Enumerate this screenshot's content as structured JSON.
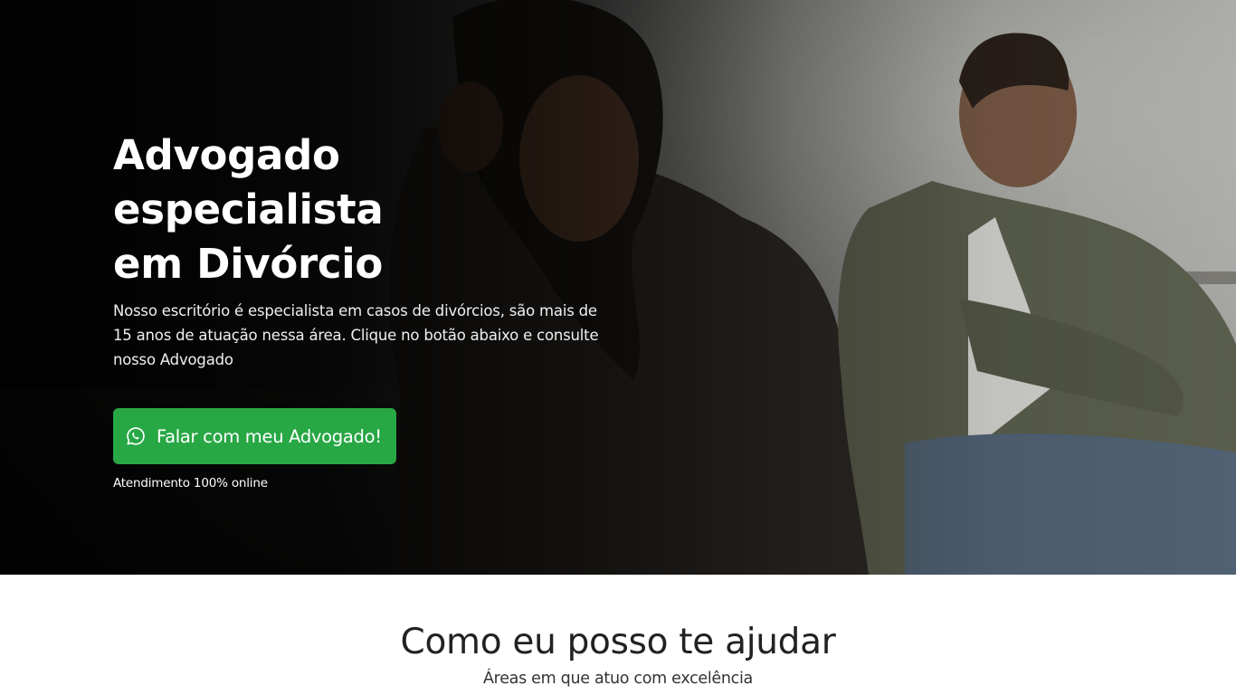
{
  "hero": {
    "title_line1": "Advogado especialista",
    "title_line2": "em Divórcio",
    "description": "Nosso escritório é especialista em casos de divórcios, são mais de 15 anos de atuação nessa área. Clique no botão abaixo e consulte nosso Advogado",
    "cta_label": "Falar com meu Advogado!",
    "cta_icon": "whatsapp-icon",
    "note": "Atendimento 100% online",
    "background_image": "couple-sitting-apart-on-sofa",
    "accent_color": "#28a745"
  },
  "services": {
    "title": "Como eu posso te ajudar",
    "subtitle": "Áreas em que atuo com excelência"
  }
}
